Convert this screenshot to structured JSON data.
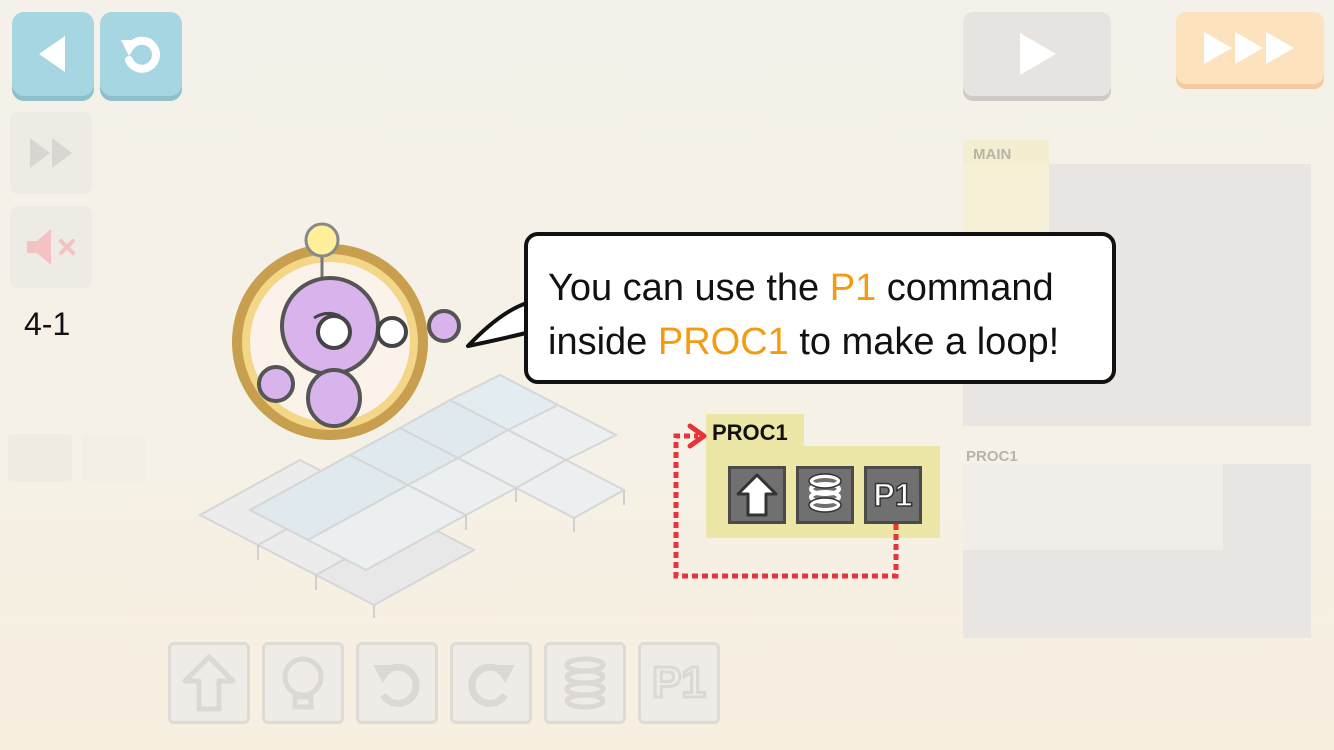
{
  "toolbar": {
    "back_icon": "back-arrow-icon",
    "reset_icon": "reset-icon",
    "step_icon": "fast-forward-icon",
    "sound_icon": "sound-muted-icon",
    "level": "4-1"
  },
  "controls": {
    "play_icon": "play-icon",
    "fast_forward_icon": "triple-arrow-icon"
  },
  "program": {
    "main_label": "MAIN",
    "proc1_label": "PROC1"
  },
  "tutorial": {
    "line1_pre": "You can use the ",
    "line1_hl": "P1",
    "line1_post": " command",
    "line2_pre": "inside ",
    "line2_hl": "PROC1",
    "line2_post": " to make a loop!",
    "proc_label": "PROC1",
    "proc_commands": [
      "forward",
      "light",
      "P1"
    ],
    "p1_text": "P1"
  },
  "palette": {
    "commands": [
      "forward",
      "light",
      "turn-left",
      "turn-right",
      "light",
      "P1"
    ],
    "p1_text": "P1"
  },
  "colors": {
    "accent": "#f39c12",
    "blue_button": "#a5d6e1",
    "proc_bg": "#ece7a6",
    "loop_arrow": "#e8323c"
  }
}
